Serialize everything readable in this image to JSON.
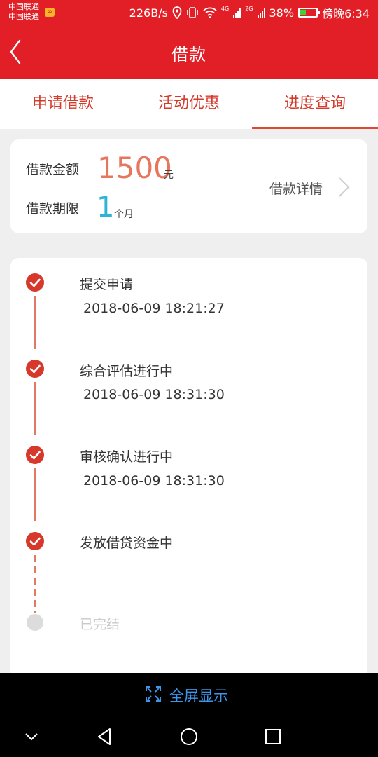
{
  "status_bar": {
    "carrier_1": "中国联通",
    "carrier_2": "中国联通",
    "carrier_icon": "weibo-badge-icon",
    "network_speed": "226B/s",
    "net_1": "4G",
    "net_2": "2G",
    "battery_percent": "38%",
    "battery_level": 0.38,
    "time": "傍晚6:34"
  },
  "header": {
    "title": "借款",
    "back_icon": "chevron-left-icon"
  },
  "tabs": [
    {
      "label": "申请借款",
      "active": false
    },
    {
      "label": "活动优惠",
      "active": false
    },
    {
      "label": "进度查询",
      "active": true
    }
  ],
  "summary": {
    "amount_label": "借款金额",
    "amount_value": "1500",
    "amount_unit": "元",
    "term_label": "借款期限",
    "term_value": "1",
    "term_unit": "个月",
    "detail_link": "借款详情"
  },
  "progress": {
    "steps": [
      {
        "title": "提交申请",
        "time": "2018-06-09 18:21:27",
        "done": true
      },
      {
        "title": "综合评估进行中",
        "time": "2018-06-09 18:31:30",
        "done": true
      },
      {
        "title": "审核确认进行中",
        "time": "2018-06-09 18:31:30",
        "done": true
      },
      {
        "title": "发放借贷资金中",
        "time": "",
        "done": true
      },
      {
        "title": "已完结",
        "time": "",
        "done": false
      }
    ]
  },
  "fullscreen": {
    "label": "全屏显示",
    "icon": "expand-icon"
  },
  "colors": {
    "brand_red": "#e21f26",
    "step_red": "#d6392b",
    "amount_color": "#e7765f",
    "term_color": "#2bb3d8",
    "link_blue": "#3f95ea"
  }
}
